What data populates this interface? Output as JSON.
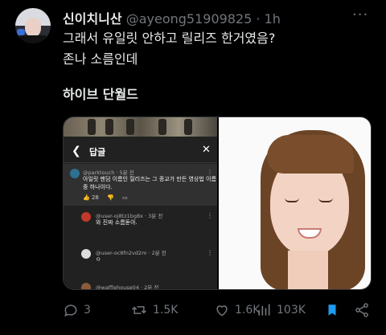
{
  "tweet": {
    "display_name": "신이치니산",
    "handle": "@ayeong51909825",
    "separator": "·",
    "time": "1h",
    "more_icon": "more-icon",
    "lines": [
      "그래서 유일릿 안하고 릴리즈 한거였음?",
      "존나 소름인데",
      "하이브 단월드"
    ]
  },
  "media": {
    "comments_panel": {
      "title": "답글",
      "comments": [
        {
          "user": "@parktouch · 5분 전",
          "text": [
            "아일릿 팬덤 이름인 릴리즈는 그 종교가 만든 영상법 이름",
            "중 하나이다."
          ],
          "likes": "28",
          "avatar_color": "#2f6f8f"
        },
        {
          "user": "@user-oj8tz1bg8x · 3분 전",
          "text": [
            "와 진짜 소름돋아."
          ],
          "avatar_color": "#c0392b"
        },
        {
          "user": "@user-oc8fn2vd2m · 2분 전",
          "text": [
            "ㅇ"
          ],
          "avatar_color": "#dddddd"
        },
        {
          "user": "@wafflehouse04 · 2분 전",
          "text": [],
          "avatar_color": "#8a5a3a"
        }
      ]
    }
  },
  "actions": {
    "reply_count": "3",
    "retweet_count": "1.5K",
    "like_count": "1.6K",
    "view_count": "103K"
  },
  "colors": {
    "background": "#000000",
    "muted": "#71767b",
    "text": "#e7e9ea",
    "bookmark_active": "#1d9bf0"
  }
}
